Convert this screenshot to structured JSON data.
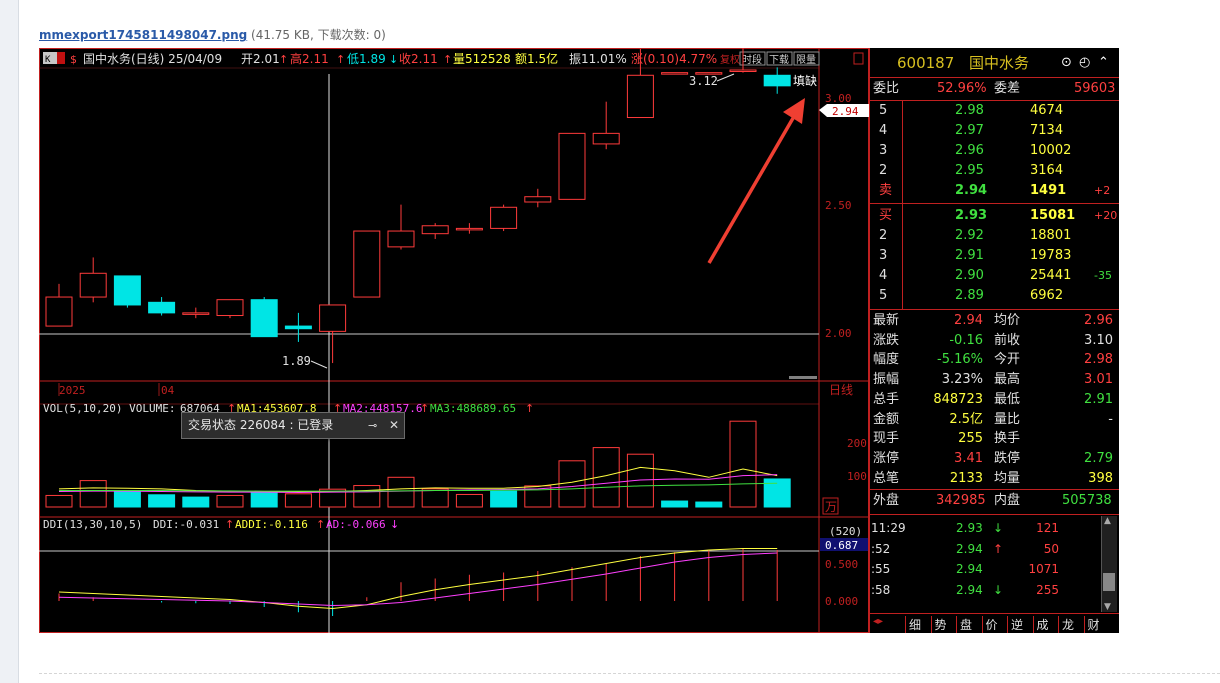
{
  "page": {
    "file_name": "mmexport1745811498047.png",
    "file_meta": "(41.75 KB, 下载次数: 0)"
  },
  "header": {
    "k_box": "K",
    "s_label": "$",
    "title": "国中水务(日线) 25/04/09",
    "open": "开2.01",
    "high": "高2.11",
    "low": "低1.89",
    "close": "收2.11",
    "volume": "量512528",
    "amount": "额1.5亿",
    "amplitude": "振11.01%",
    "change": "涨(0.10)4.77%",
    "btn_fuquan": "复权",
    "btn_shiduan": "时段",
    "btn_xiazai": "下载",
    "btn_xianliang": "限量"
  },
  "main_chart": {
    "annot_high": "3.12",
    "annot_low": "1.89",
    "tianque": "填缺",
    "price_ticks": [
      "3.00",
      "2.50",
      "2.00"
    ],
    "current_price": "2.94",
    "x_labels": [
      "2025",
      "04"
    ],
    "period_label": "日线"
  },
  "volume_chart": {
    "legend_name": "VOL(5,10,20) VOLUME:",
    "legend_volume": "687064",
    "legend_ma1": "MA1:453607.8",
    "legend_ma2": "MA2:448157.6",
    "legend_ma3": "MA3:488689.65",
    "ticks": [
      "200",
      "100"
    ],
    "unit": "万"
  },
  "ddi_chart": {
    "legend_name": "DDI(13,30,10,5)",
    "legend_ddi": "DDI:-0.031",
    "legend_addi": "ADDI:-0.116",
    "legend_ad": "AD:-0.066",
    "count_label": "(520)",
    "value_box": "0.687",
    "ticks": [
      "0.500",
      "0.000"
    ]
  },
  "popup": {
    "text": "交易状态 226084 : 已登录",
    "pin_icon": "⊸",
    "close_icon": "✕"
  },
  "quote": {
    "code": "600187",
    "name": "国中水务",
    "weibi_label": "委比",
    "weibi_value": "52.96%",
    "weicha_label": "委差",
    "weicha_value": "59603",
    "asks": [
      {
        "level": "5",
        "price": "2.98",
        "vol": "4674",
        "chg": ""
      },
      {
        "level": "4",
        "price": "2.97",
        "vol": "7134",
        "chg": ""
      },
      {
        "level": "3",
        "price": "2.96",
        "vol": "10002",
        "chg": ""
      },
      {
        "level": "2",
        "price": "2.95",
        "vol": "3164",
        "chg": ""
      },
      {
        "level": "卖",
        "price": "2.94",
        "vol": "1491",
        "chg": "+2"
      }
    ],
    "bids": [
      {
        "level": "买",
        "price": "2.93",
        "vol": "15081",
        "chg": "+20"
      },
      {
        "level": "2",
        "price": "2.92",
        "vol": "18801",
        "chg": ""
      },
      {
        "level": "3",
        "price": "2.91",
        "vol": "19783",
        "chg": ""
      },
      {
        "level": "4",
        "price": "2.90",
        "vol": "25441",
        "chg": "-35"
      },
      {
        "level": "5",
        "price": "2.89",
        "vol": "6962",
        "chg": ""
      }
    ],
    "stats": [
      {
        "l1": "最新",
        "v1": "2.94",
        "l2": "均价",
        "v2": "2.96"
      },
      {
        "l1": "涨跌",
        "v1": "-0.16",
        "l2": "前收",
        "v2": "3.10"
      },
      {
        "l1": "幅度",
        "v1": "-5.16%",
        "l2": "今开",
        "v2": "2.98"
      },
      {
        "l1": "振幅",
        "v1": "3.23%",
        "l2": "最高",
        "v2": "3.01"
      },
      {
        "l1": "总手",
        "v1": "848723",
        "l2": "最低",
        "v2": "2.91"
      },
      {
        "l1": "金额",
        "v1": "2.5亿",
        "l2": "量比",
        "v2": "-"
      },
      {
        "l1": "现手",
        "v1": "255",
        "l2": "换手",
        "v2": ""
      },
      {
        "l1": "涨停",
        "v1": "3.41",
        "l2": "跌停",
        "v2": "2.79"
      },
      {
        "l1": "总笔",
        "v1": "2133",
        "l2": "均量",
        "v2": "398"
      }
    ],
    "waipan_label": "外盘",
    "waipan_value": "342985",
    "neipan_label": "内盘",
    "neipan_value": "505738",
    "ticks": [
      {
        "time": "11:29",
        "price": "2.93",
        "dir": "↓",
        "vol": "121"
      },
      {
        "time": ":52",
        "price": "2.94",
        "dir": "↑",
        "vol": "50"
      },
      {
        "time": ":55",
        "price": "2.94",
        "dir": "",
        "vol": "1071"
      },
      {
        "time": ":58",
        "price": "2.94",
        "dir": "↓",
        "vol": "255"
      }
    ],
    "tabs": [
      "细",
      "势",
      "盘",
      "价",
      "逆",
      "成",
      "龙",
      "财"
    ]
  },
  "colors": {
    "up": "#ff3b3b",
    "down": "#00e5e5",
    "yellow": "#ffff40",
    "green": "#40e040",
    "frame": "#c02020"
  },
  "chart_data": [
    {
      "type": "candlestick",
      "title": "国中水务(日线)",
      "ylim": [
        1.8,
        3.2
      ],
      "candles": [
        {
          "open": 2.03,
          "close": 2.14,
          "high": 2.19,
          "low": 2.03
        },
        {
          "open": 2.14,
          "close": 2.23,
          "high": 2.29,
          "low": 2.12
        },
        {
          "open": 2.22,
          "close": 2.11,
          "high": 2.22,
          "low": 2.1
        },
        {
          "open": 2.12,
          "close": 2.08,
          "high": 2.14,
          "low": 2.07
        },
        {
          "open": 2.08,
          "close": 2.08,
          "high": 2.1,
          "low": 2.06
        },
        {
          "open": 2.07,
          "close": 2.13,
          "high": 2.13,
          "low": 2.06
        },
        {
          "open": 2.13,
          "close": 1.99,
          "high": 2.14,
          "low": 1.99
        },
        {
          "open": 2.03,
          "close": 2.02,
          "high": 2.08,
          "low": 1.97
        },
        {
          "open": 2.01,
          "close": 2.11,
          "high": 2.11,
          "low": 1.89
        },
        {
          "open": 2.14,
          "close": 2.39,
          "high": 2.39,
          "low": 2.14
        },
        {
          "open": 2.33,
          "close": 2.39,
          "high": 2.49,
          "low": 2.32
        },
        {
          "open": 2.38,
          "close": 2.41,
          "high": 2.42,
          "low": 2.36
        },
        {
          "open": 2.4,
          "close": 2.4,
          "high": 2.42,
          "low": 2.38
        },
        {
          "open": 2.4,
          "close": 2.48,
          "high": 2.49,
          "low": 2.39
        },
        {
          "open": 2.5,
          "close": 2.52,
          "high": 2.55,
          "low": 2.48
        },
        {
          "open": 2.51,
          "close": 2.76,
          "high": 2.76,
          "low": 2.51
        },
        {
          "open": 2.72,
          "close": 2.76,
          "high": 2.88,
          "low": 2.7
        },
        {
          "open": 2.82,
          "close": 2.98,
          "high": 3.08,
          "low": 2.82
        },
        {
          "open": 2.99,
          "close": 2.99,
          "high": 2.99,
          "low": 2.99
        },
        {
          "open": 2.99,
          "close": 2.99,
          "high": 2.99,
          "low": 2.99
        },
        {
          "open": 3.0,
          "close": 3.0,
          "high": 3.12,
          "low": 2.99
        },
        {
          "open": 2.98,
          "close": 2.94,
          "high": 3.01,
          "low": 2.91
        }
      ]
    },
    {
      "type": "bar",
      "title": "VOL(5,10,20)",
      "ylim": [
        0,
        280
      ],
      "values": [
        35,
        80,
        50,
        37,
        30,
        35,
        44,
        40,
        54,
        65,
        90,
        55,
        38,
        48,
        64,
        140,
        180,
        160,
        18,
        15,
        260,
        85
      ],
      "directions": [
        "up",
        "up",
        "down",
        "down",
        "down",
        "up",
        "down",
        "up",
        "up",
        "up",
        "up",
        "up",
        "up",
        "down",
        "up",
        "up",
        "up",
        "up",
        "down",
        "down",
        "up",
        "down"
      ],
      "ma_lines": [
        {
          "name": "MA1",
          "values": [
            55,
            58,
            57,
            55,
            50,
            48,
            47,
            46,
            47,
            50,
            55,
            58,
            57,
            57,
            62,
            75,
            95,
            120,
            110,
            90,
            115,
            95
          ]
        },
        {
          "name": "MA2",
          "values": [
            47,
            48,
            48,
            47,
            46,
            45,
            45,
            44,
            45,
            46,
            48,
            50,
            52,
            53,
            55,
            62,
            72,
            82,
            85,
            84,
            95,
            98
          ]
        },
        {
          "name": "MA3",
          "values": [
            50,
            50,
            50,
            50,
            49,
            49,
            48,
            48,
            48,
            48,
            49,
            50,
            50,
            51,
            52,
            55,
            60,
            64,
            66,
            67,
            70,
            72
          ]
        }
      ]
    },
    {
      "type": "line",
      "title": "DDI(13,30,10,5)",
      "ylim": [
        -0.25,
        0.85
      ],
      "bars": [
        0.1,
        0.05,
        0.0,
        -0.02,
        -0.03,
        -0.04,
        -0.08,
        -0.15,
        -0.2,
        0.05,
        0.25,
        0.3,
        0.35,
        0.38,
        0.4,
        0.45,
        0.5,
        0.6,
        0.65,
        0.68,
        0.7,
        0.68
      ],
      "series": [
        {
          "name": "ADDI",
          "values": [
            0.12,
            0.1,
            0.08,
            0.06,
            0.04,
            0.02,
            -0.02,
            -0.07,
            -0.1,
            -0.05,
            0.06,
            0.15,
            0.22,
            0.28,
            0.34,
            0.42,
            0.5,
            0.58,
            0.64,
            0.68,
            0.7,
            0.7
          ]
        },
        {
          "name": "AD",
          "values": [
            0.05,
            0.04,
            0.03,
            0.02,
            0.01,
            0.0,
            -0.02,
            -0.04,
            -0.06,
            -0.05,
            -0.02,
            0.04,
            0.1,
            0.16,
            0.22,
            0.29,
            0.36,
            0.44,
            0.52,
            0.58,
            0.62,
            0.64
          ]
        }
      ]
    }
  ]
}
